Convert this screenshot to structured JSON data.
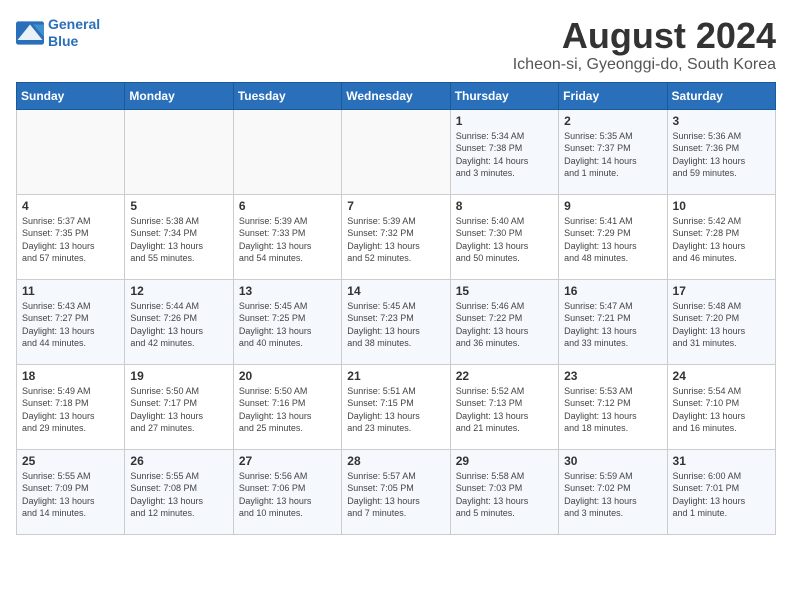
{
  "header": {
    "logo_line1": "General",
    "logo_line2": "Blue",
    "month_title": "August 2024",
    "subtitle": "Icheon-si, Gyeonggi-do, South Korea"
  },
  "weekdays": [
    "Sunday",
    "Monday",
    "Tuesday",
    "Wednesday",
    "Thursday",
    "Friday",
    "Saturday"
  ],
  "weeks": [
    [
      {
        "day": "",
        "info": ""
      },
      {
        "day": "",
        "info": ""
      },
      {
        "day": "",
        "info": ""
      },
      {
        "day": "",
        "info": ""
      },
      {
        "day": "1",
        "info": "Sunrise: 5:34 AM\nSunset: 7:38 PM\nDaylight: 14 hours\nand 3 minutes."
      },
      {
        "day": "2",
        "info": "Sunrise: 5:35 AM\nSunset: 7:37 PM\nDaylight: 14 hours\nand 1 minute."
      },
      {
        "day": "3",
        "info": "Sunrise: 5:36 AM\nSunset: 7:36 PM\nDaylight: 13 hours\nand 59 minutes."
      }
    ],
    [
      {
        "day": "4",
        "info": "Sunrise: 5:37 AM\nSunset: 7:35 PM\nDaylight: 13 hours\nand 57 minutes."
      },
      {
        "day": "5",
        "info": "Sunrise: 5:38 AM\nSunset: 7:34 PM\nDaylight: 13 hours\nand 55 minutes."
      },
      {
        "day": "6",
        "info": "Sunrise: 5:39 AM\nSunset: 7:33 PM\nDaylight: 13 hours\nand 54 minutes."
      },
      {
        "day": "7",
        "info": "Sunrise: 5:39 AM\nSunset: 7:32 PM\nDaylight: 13 hours\nand 52 minutes."
      },
      {
        "day": "8",
        "info": "Sunrise: 5:40 AM\nSunset: 7:30 PM\nDaylight: 13 hours\nand 50 minutes."
      },
      {
        "day": "9",
        "info": "Sunrise: 5:41 AM\nSunset: 7:29 PM\nDaylight: 13 hours\nand 48 minutes."
      },
      {
        "day": "10",
        "info": "Sunrise: 5:42 AM\nSunset: 7:28 PM\nDaylight: 13 hours\nand 46 minutes."
      }
    ],
    [
      {
        "day": "11",
        "info": "Sunrise: 5:43 AM\nSunset: 7:27 PM\nDaylight: 13 hours\nand 44 minutes."
      },
      {
        "day": "12",
        "info": "Sunrise: 5:44 AM\nSunset: 7:26 PM\nDaylight: 13 hours\nand 42 minutes."
      },
      {
        "day": "13",
        "info": "Sunrise: 5:45 AM\nSunset: 7:25 PM\nDaylight: 13 hours\nand 40 minutes."
      },
      {
        "day": "14",
        "info": "Sunrise: 5:45 AM\nSunset: 7:23 PM\nDaylight: 13 hours\nand 38 minutes."
      },
      {
        "day": "15",
        "info": "Sunrise: 5:46 AM\nSunset: 7:22 PM\nDaylight: 13 hours\nand 36 minutes."
      },
      {
        "day": "16",
        "info": "Sunrise: 5:47 AM\nSunset: 7:21 PM\nDaylight: 13 hours\nand 33 minutes."
      },
      {
        "day": "17",
        "info": "Sunrise: 5:48 AM\nSunset: 7:20 PM\nDaylight: 13 hours\nand 31 minutes."
      }
    ],
    [
      {
        "day": "18",
        "info": "Sunrise: 5:49 AM\nSunset: 7:18 PM\nDaylight: 13 hours\nand 29 minutes."
      },
      {
        "day": "19",
        "info": "Sunrise: 5:50 AM\nSunset: 7:17 PM\nDaylight: 13 hours\nand 27 minutes."
      },
      {
        "day": "20",
        "info": "Sunrise: 5:50 AM\nSunset: 7:16 PM\nDaylight: 13 hours\nand 25 minutes."
      },
      {
        "day": "21",
        "info": "Sunrise: 5:51 AM\nSunset: 7:15 PM\nDaylight: 13 hours\nand 23 minutes."
      },
      {
        "day": "22",
        "info": "Sunrise: 5:52 AM\nSunset: 7:13 PM\nDaylight: 13 hours\nand 21 minutes."
      },
      {
        "day": "23",
        "info": "Sunrise: 5:53 AM\nSunset: 7:12 PM\nDaylight: 13 hours\nand 18 minutes."
      },
      {
        "day": "24",
        "info": "Sunrise: 5:54 AM\nSunset: 7:10 PM\nDaylight: 13 hours\nand 16 minutes."
      }
    ],
    [
      {
        "day": "25",
        "info": "Sunrise: 5:55 AM\nSunset: 7:09 PM\nDaylight: 13 hours\nand 14 minutes."
      },
      {
        "day": "26",
        "info": "Sunrise: 5:55 AM\nSunset: 7:08 PM\nDaylight: 13 hours\nand 12 minutes."
      },
      {
        "day": "27",
        "info": "Sunrise: 5:56 AM\nSunset: 7:06 PM\nDaylight: 13 hours\nand 10 minutes."
      },
      {
        "day": "28",
        "info": "Sunrise: 5:57 AM\nSunset: 7:05 PM\nDaylight: 13 hours\nand 7 minutes."
      },
      {
        "day": "29",
        "info": "Sunrise: 5:58 AM\nSunset: 7:03 PM\nDaylight: 13 hours\nand 5 minutes."
      },
      {
        "day": "30",
        "info": "Sunrise: 5:59 AM\nSunset: 7:02 PM\nDaylight: 13 hours\nand 3 minutes."
      },
      {
        "day": "31",
        "info": "Sunrise: 6:00 AM\nSunset: 7:01 PM\nDaylight: 13 hours\nand 1 minute."
      }
    ]
  ]
}
